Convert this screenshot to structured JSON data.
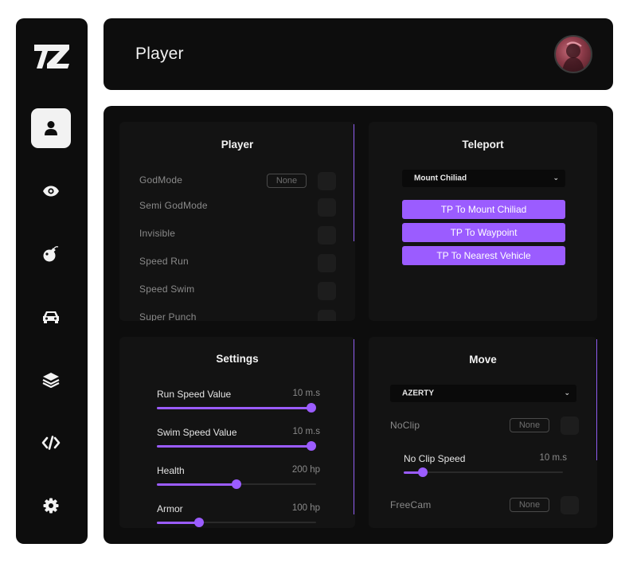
{
  "header": {
    "title": "Player"
  },
  "sidebar": {
    "items": [
      {
        "icon": "user-icon",
        "active": true
      },
      {
        "icon": "eye-icon",
        "active": false
      },
      {
        "icon": "bomb-icon",
        "active": false
      },
      {
        "icon": "car-icon",
        "active": false
      },
      {
        "icon": "layers-icon",
        "active": false
      },
      {
        "icon": "code-icon",
        "active": false
      },
      {
        "icon": "gear-icon",
        "active": false
      }
    ]
  },
  "player": {
    "title": "Player",
    "options": [
      {
        "label": "GodMode",
        "key": "None",
        "checked": false
      },
      {
        "label": "Semi GodMode",
        "checked": false
      },
      {
        "label": "Invisible",
        "checked": false
      },
      {
        "label": "Speed Run",
        "checked": false
      },
      {
        "label": "Speed Swim",
        "checked": false
      },
      {
        "label": "Super Punch",
        "checked": false
      }
    ]
  },
  "teleport": {
    "title": "Teleport",
    "dropdown_value": "Mount Chiliad",
    "buttons": [
      "TP To  Mount Chiliad",
      "TP To Waypoint",
      "TP To Nearest Vehicle"
    ]
  },
  "settings": {
    "title": "Settings",
    "sliders": [
      {
        "label": "Run Speed Value",
        "value": "10 m.s",
        "fraction": 0.97
      },
      {
        "label": "Swim Speed Value",
        "value": "10 m.s",
        "fraction": 0.97
      },
      {
        "label": "Health",
        "value": "200 hp",
        "fraction": 0.5
      },
      {
        "label": "Armor",
        "value": "100 hp",
        "fraction": 0.265
      }
    ]
  },
  "move": {
    "title": "Move",
    "dropdown_value": "AZERTY",
    "noclip": {
      "label": "NoClip",
      "key": "None",
      "checked": false
    },
    "noclip_speed": {
      "label": "No Clip Speed",
      "value": "10 m.s",
      "fraction": 0.12
    },
    "freecam": {
      "label": "FreeCam",
      "key": "None",
      "checked": false
    }
  },
  "colors": {
    "accent": "#9b5cff",
    "panel": "#131313",
    "background": "#0d0d0d"
  }
}
